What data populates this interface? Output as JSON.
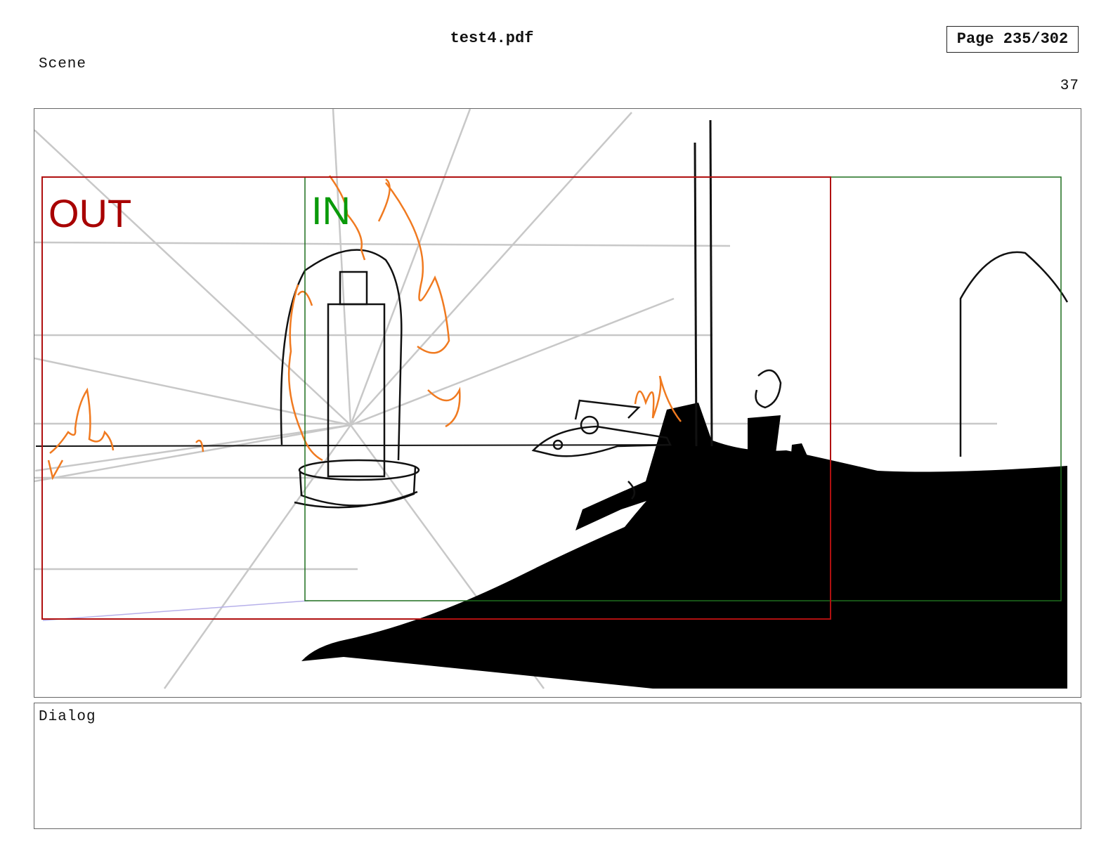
{
  "header": {
    "doc_title": "test4.pdf",
    "page_indicator": "Page 235/302"
  },
  "scene": {
    "label": "Scene",
    "panel_number": "37"
  },
  "frame": {
    "out_label": "OUT",
    "in_label": "IN",
    "out_color": "#a80000",
    "in_color": "#0a9a0a",
    "flame_color": "#f07a20",
    "guide_color": "#c8c8c8"
  },
  "dialog": {
    "label": "Dialog",
    "text": ""
  }
}
